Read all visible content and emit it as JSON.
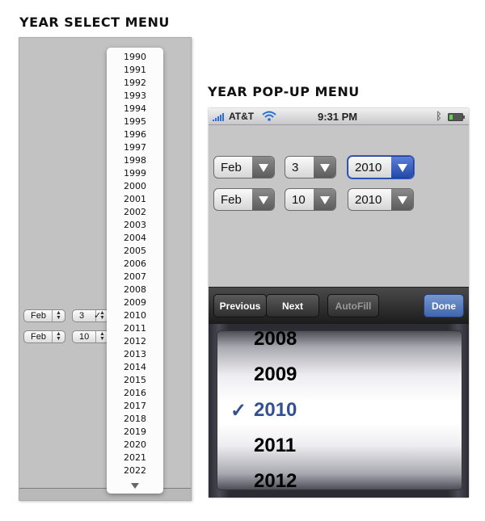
{
  "headings": {
    "left": "YEAR SELECT MENU",
    "right": "YEAR POP-UP MENU"
  },
  "select_menu": {
    "rows": [
      {
        "month": "Feb",
        "day": "3"
      },
      {
        "month": "Feb",
        "day": "10"
      }
    ],
    "years": [
      "1990",
      "1991",
      "1992",
      "1993",
      "1994",
      "1995",
      "1996",
      "1997",
      "1998",
      "1999",
      "2000",
      "2001",
      "2002",
      "2003",
      "2004",
      "2005",
      "2006",
      "2007",
      "2008",
      "2009",
      "2010",
      "2011",
      "2012",
      "2013",
      "2014",
      "2015",
      "2016",
      "2017",
      "2018",
      "2019",
      "2020",
      "2021",
      "2022"
    ],
    "selected_year": "2010",
    "check_glyph": "✓",
    "scroll_icon": "triangle-down-icon"
  },
  "phone": {
    "status_bar": {
      "carrier": "AT&T",
      "time": "9:31 PM"
    },
    "rows": [
      {
        "month": "Feb",
        "day": "3",
        "year": "2010",
        "active": true
      },
      {
        "month": "Feb",
        "day": "10",
        "year": "2010",
        "active": false
      }
    ],
    "toolbar": {
      "previous": "Previous",
      "next": "Next",
      "autofill": "AutoFill",
      "done": "Done"
    },
    "picker": {
      "items": [
        "2008",
        "2009",
        "2010",
        "2011",
        "2012"
      ],
      "selected": "2010",
      "check_glyph": "✓"
    },
    "colors": {
      "selected_blue": "#34518f",
      "done_blue": "#4f74bd"
    }
  }
}
